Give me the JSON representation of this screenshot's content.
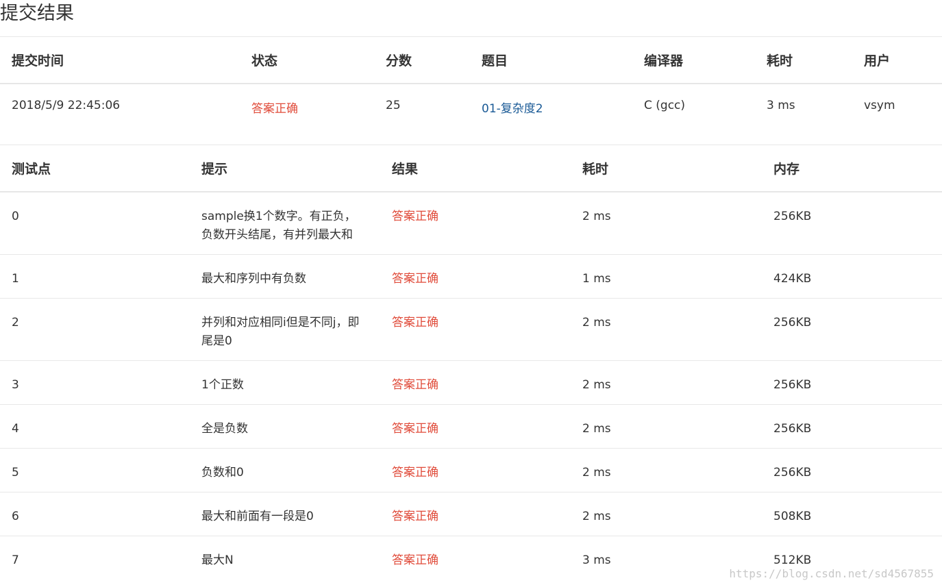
{
  "page": {
    "title": "提交结果"
  },
  "summary": {
    "headers": [
      "提交时间",
      "状态",
      "分数",
      "题目",
      "编译器",
      "耗时",
      "用户"
    ],
    "row": {
      "submit_time": "2018/5/9 22:45:06",
      "status": "答案正确",
      "score": "25",
      "problem": "01-复杂度2",
      "compiler": "C (gcc)",
      "time": "3 ms",
      "user": "vsym"
    }
  },
  "cases": {
    "headers": [
      "测试点",
      "提示",
      "结果",
      "耗时",
      "内存"
    ],
    "rows": [
      {
        "id": "0",
        "hint": "sample换1个数字。有正负，负数开头结尾，有并列最大和",
        "result": "答案正确",
        "time": "2 ms",
        "memory": "256KB"
      },
      {
        "id": "1",
        "hint": "最大和序列中有负数",
        "result": "答案正确",
        "time": "1 ms",
        "memory": "424KB"
      },
      {
        "id": "2",
        "hint": "并列和对应相同i但是不同j，即尾是0",
        "result": "答案正确",
        "time": "2 ms",
        "memory": "256KB"
      },
      {
        "id": "3",
        "hint": "1个正数",
        "result": "答案正确",
        "time": "2 ms",
        "memory": "256KB"
      },
      {
        "id": "4",
        "hint": "全是负数",
        "result": "答案正确",
        "time": "2 ms",
        "memory": "256KB"
      },
      {
        "id": "5",
        "hint": "负数和0",
        "result": "答案正确",
        "time": "2 ms",
        "memory": "256KB"
      },
      {
        "id": "6",
        "hint": "最大和前面有一段是0",
        "result": "答案正确",
        "time": "2 ms",
        "memory": "508KB"
      },
      {
        "id": "7",
        "hint": "最大N",
        "result": "答案正确",
        "time": "3 ms",
        "memory": "512KB"
      }
    ]
  },
  "watermark": "https://blog.csdn.net/sd4567855",
  "colors": {
    "success": "#e04b3a",
    "link": "#1a5a96"
  }
}
